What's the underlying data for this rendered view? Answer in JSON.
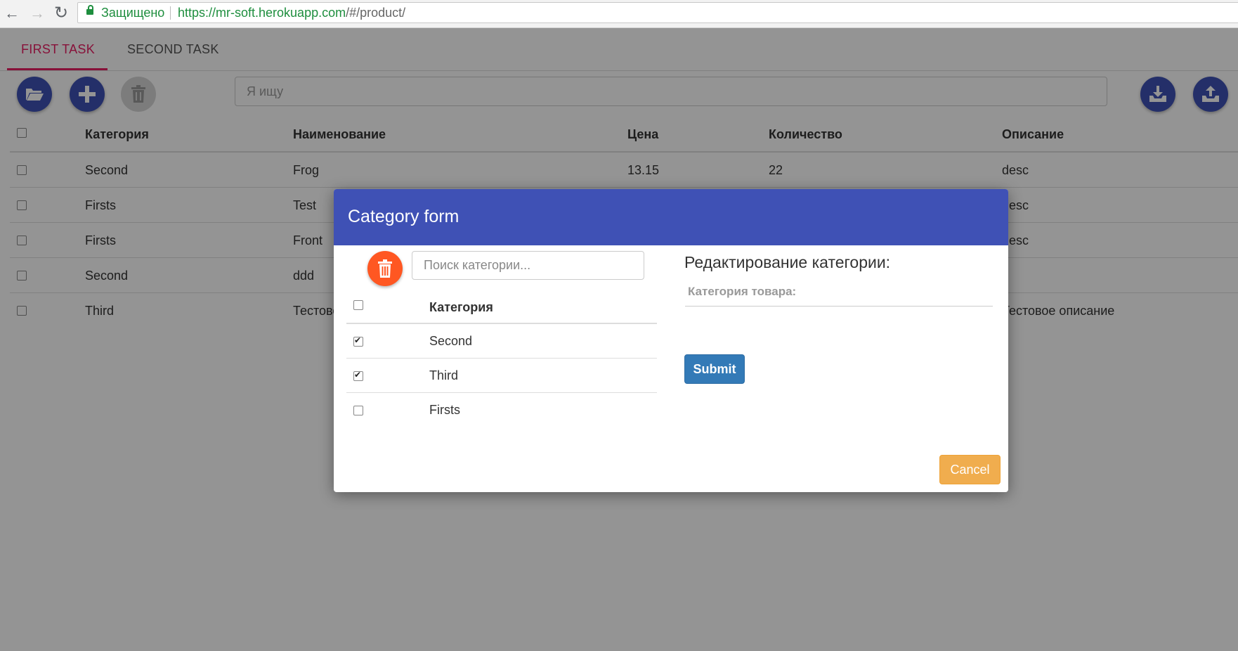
{
  "browser": {
    "secure_label": "Защищено",
    "url_host": "https://mr-soft.herokuapp.com",
    "url_path": "/#/product/"
  },
  "tabs": [
    {
      "label": "FIRST TASK",
      "active": true
    },
    {
      "label": "SECOND TASK",
      "active": false
    }
  ],
  "toolbar": {
    "search_placeholder": "Я ищу",
    "buttons": [
      "folder-open-icon",
      "plus-icon",
      "trash-icon",
      "download-icon",
      "upload-icon"
    ]
  },
  "products": {
    "columns": [
      "Категория",
      "Наименование",
      "Цена",
      "Количество",
      "Описание"
    ],
    "rows": [
      {
        "category": "Second",
        "name": "Frog",
        "price": "13.15",
        "qty": "22",
        "desc": "desc"
      },
      {
        "category": "Firsts",
        "name": "Test",
        "price": "",
        "qty": "",
        "desc": "desc"
      },
      {
        "category": "Firsts",
        "name": "Front",
        "price": "",
        "qty": "",
        "desc": "desc"
      },
      {
        "category": "Second",
        "name": "ddd",
        "price": "",
        "qty": "",
        "desc": ""
      },
      {
        "category": "Third",
        "name": "Тестово",
        "price": "",
        "qty": "",
        "desc": "Тестовое описание"
      }
    ]
  },
  "modal": {
    "title": "Category form",
    "search_placeholder": "Поиск категории...",
    "column_header": "Категория",
    "categories": [
      {
        "label": "Second",
        "checked": true
      },
      {
        "label": "Third",
        "checked": true
      },
      {
        "label": "Firsts",
        "checked": false
      }
    ],
    "edit_title": "Редактирование категории:",
    "edit_placeholder": "Категория товара:",
    "submit_label": "Submit",
    "cancel_label": "Cancel"
  },
  "colors": {
    "primary": "#3f51b5",
    "accent": "#e91e63",
    "danger_fab": "#ff5722",
    "submit": "#337ab7",
    "cancel": "#f0ad4e"
  }
}
